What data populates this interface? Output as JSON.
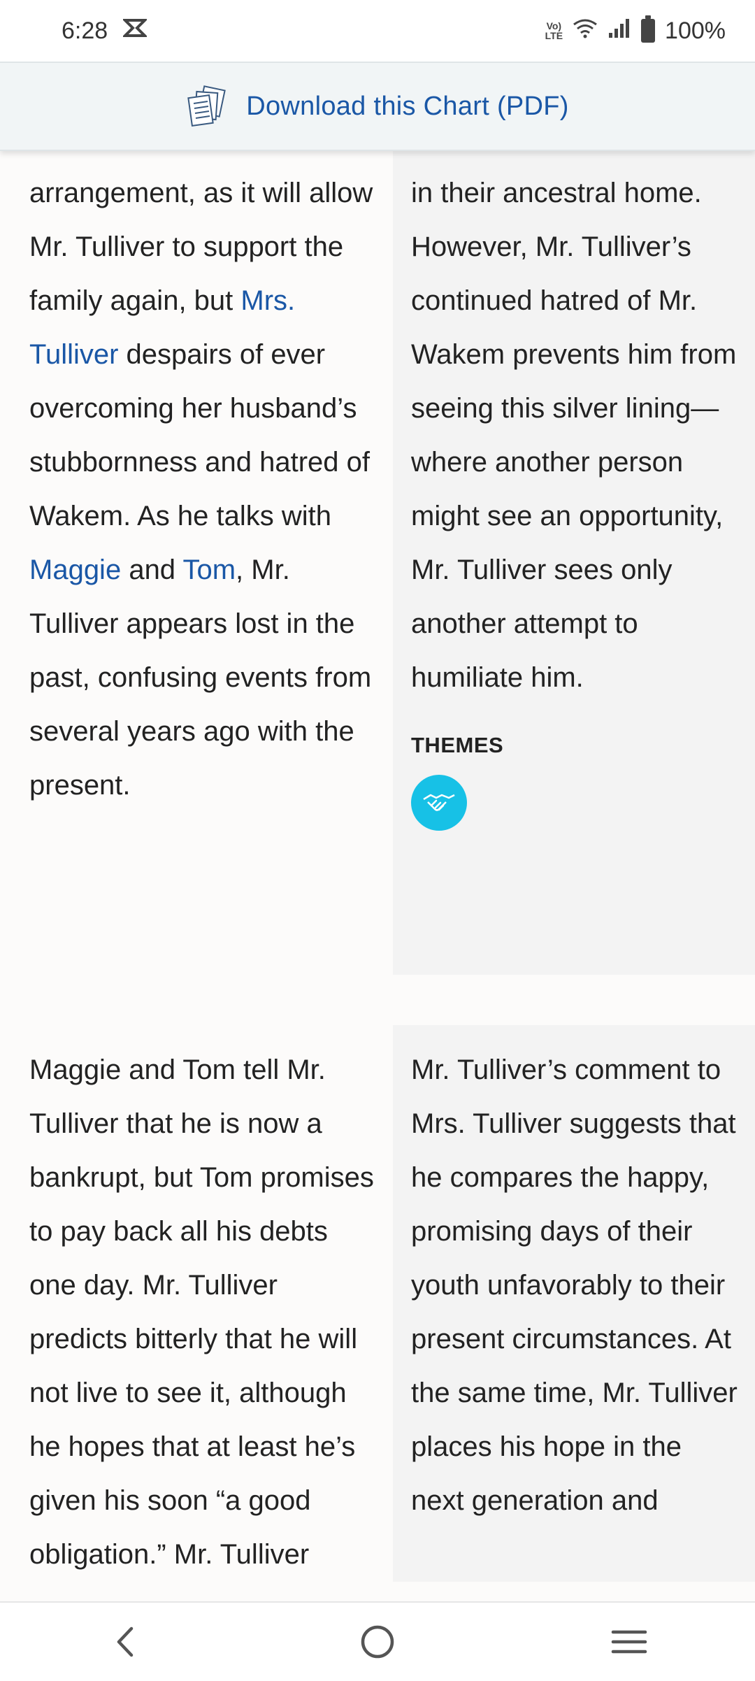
{
  "status_bar": {
    "time": "6:28",
    "battery": "100%",
    "network": "Vo)) LTE",
    "icons": [
      "notification-icon",
      "lte-icon",
      "wifi-icon",
      "signal-icon",
      "battery-icon"
    ]
  },
  "download_banner": {
    "icon": "document-stack-icon",
    "label": "Download this Chart (PDF)"
  },
  "rows": [
    {
      "left": [
        {
          "text": "arrangement, as it will allow Mr. Tulliver to support the family again, but "
        },
        {
          "link": "Mrs. Tulliver"
        },
        {
          "text": " despairs of ever overcoming her husband’s stubbornness and hatred of Wakem. As he talks with "
        },
        {
          "link": "Maggie"
        },
        {
          "text": " and "
        },
        {
          "link": "Tom"
        },
        {
          "text": ", Mr. Tulliver appears lost in the past, confusing events from several years ago with the present."
        }
      ],
      "right": "in their ancestral home. However, Mr. Tulliver’s continued hatred of Mr. Wakem prevents him from seeing this silver lining—where another person might see an opportunity, Mr. Tulliver sees only another attempt to humiliate him.",
      "themes_label": "THEMES",
      "theme_icon": "handshake-icon",
      "theme_color": "#17c1e6"
    },
    {
      "left": "Maggie and Tom tell Mr. Tulliver that he is now a bankrupt, but Tom promises to pay back all his debts one day. Mr. Tulliver predicts bitterly that he will not live to see it, although he hopes that at least he’s given his soon “a good obligation.” Mr. Tulliver",
      "right": "Mr. Tulliver’s comment to Mrs. Tulliver suggests that he compares the happy, promising days of their youth unfavorably to their present circumstances. At the same time, Mr. Tulliver places his hope in the next generation and"
    }
  ],
  "nav_bar": {
    "icons": [
      "back-icon",
      "home-icon",
      "menu-icon"
    ]
  },
  "colors": {
    "link": "#1a57a6",
    "banner_bg": "#f1f5f6",
    "analysis_bg": "#f3f3f3"
  }
}
